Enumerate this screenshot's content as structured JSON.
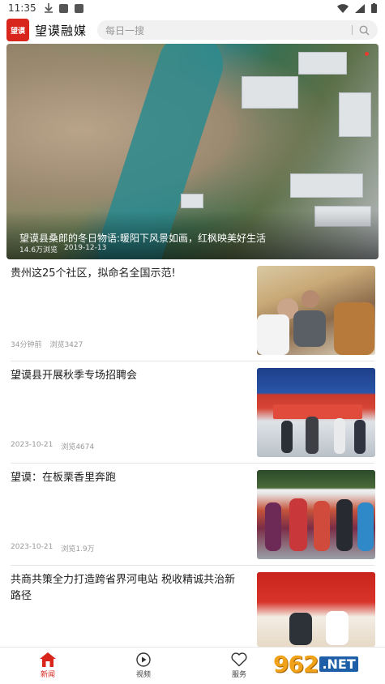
{
  "status_bar": {
    "time": "11:35"
  },
  "header": {
    "logo_text": "望谟",
    "app_name": "望谟融媒",
    "search_placeholder": "每日一搜"
  },
  "hero": {
    "caption": "望谟县桑郎的冬日物语:暖阳下风景如画，红枫映美好生活",
    "views": "14.6万浏览",
    "date": "2019-12-13"
  },
  "news": [
    {
      "title": "贵州这25个社区，拟命名全国示范!",
      "time": "34分钟前",
      "views": "浏览3427"
    },
    {
      "title": "望谟县开展秋季专场招聘会",
      "time": "2023-10-21",
      "views": "浏览4674"
    },
    {
      "title": "望谟：在板栗香里奔跑",
      "time": "2023-10-21",
      "views": "浏览1.9万"
    },
    {
      "title": "共商共策全力打造跨省界河电站 税收精诚共治新路径",
      "time": "",
      "views": ""
    }
  ],
  "tabs": [
    {
      "label": "新闻",
      "icon": "home-icon"
    },
    {
      "label": "视频",
      "icon": "play-icon"
    },
    {
      "label": "服务",
      "icon": "heart-icon"
    }
  ],
  "watermark": {
    "number": "962",
    "suffix": ".NET"
  }
}
